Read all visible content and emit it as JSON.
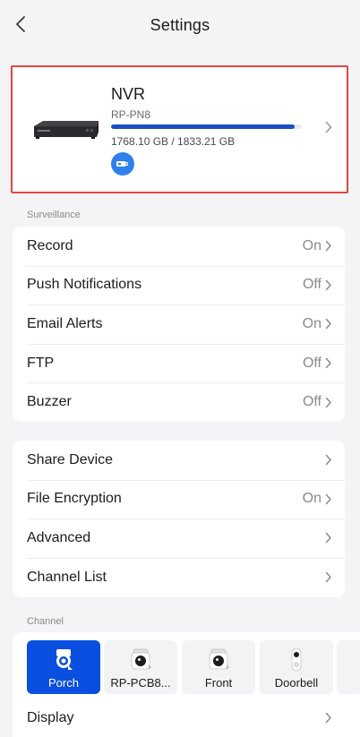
{
  "header": {
    "title": "Settings"
  },
  "device": {
    "name": "NVR",
    "model": "RP-PN8",
    "storage_text": "1768.10 GB / 1833.21 GB",
    "storage_used_fraction": 0.9645
  },
  "surveillance": {
    "section_label": "Surveillance",
    "rows": [
      {
        "label": "Record",
        "value": "On"
      },
      {
        "label": "Push Notifications",
        "value": "Off"
      },
      {
        "label": "Email Alerts",
        "value": "On"
      },
      {
        "label": "FTP",
        "value": "Off"
      },
      {
        "label": "Buzzer",
        "value": "Off"
      }
    ]
  },
  "general": {
    "rows": [
      {
        "label": "Share Device",
        "value": ""
      },
      {
        "label": "File Encryption",
        "value": "On"
      },
      {
        "label": "Advanced",
        "value": ""
      },
      {
        "label": "Channel List",
        "value": ""
      }
    ]
  },
  "channel": {
    "section_label": "Channel",
    "tiles": [
      {
        "name": "Porch",
        "icon": "camera-icon",
        "active": true
      },
      {
        "name": "RP-PCB8...",
        "icon": "camera-offline-icon",
        "active": false
      },
      {
        "name": "Front",
        "icon": "camera-offline-icon",
        "active": false
      },
      {
        "name": "Doorbell",
        "icon": "doorbell-icon",
        "active": false
      }
    ],
    "display_label": "Display"
  },
  "colors": {
    "accent": "#0a4fe0",
    "storage_fill": "#1a4fc2",
    "highlight_border": "#e2463f",
    "badge": "#2f80ed"
  }
}
